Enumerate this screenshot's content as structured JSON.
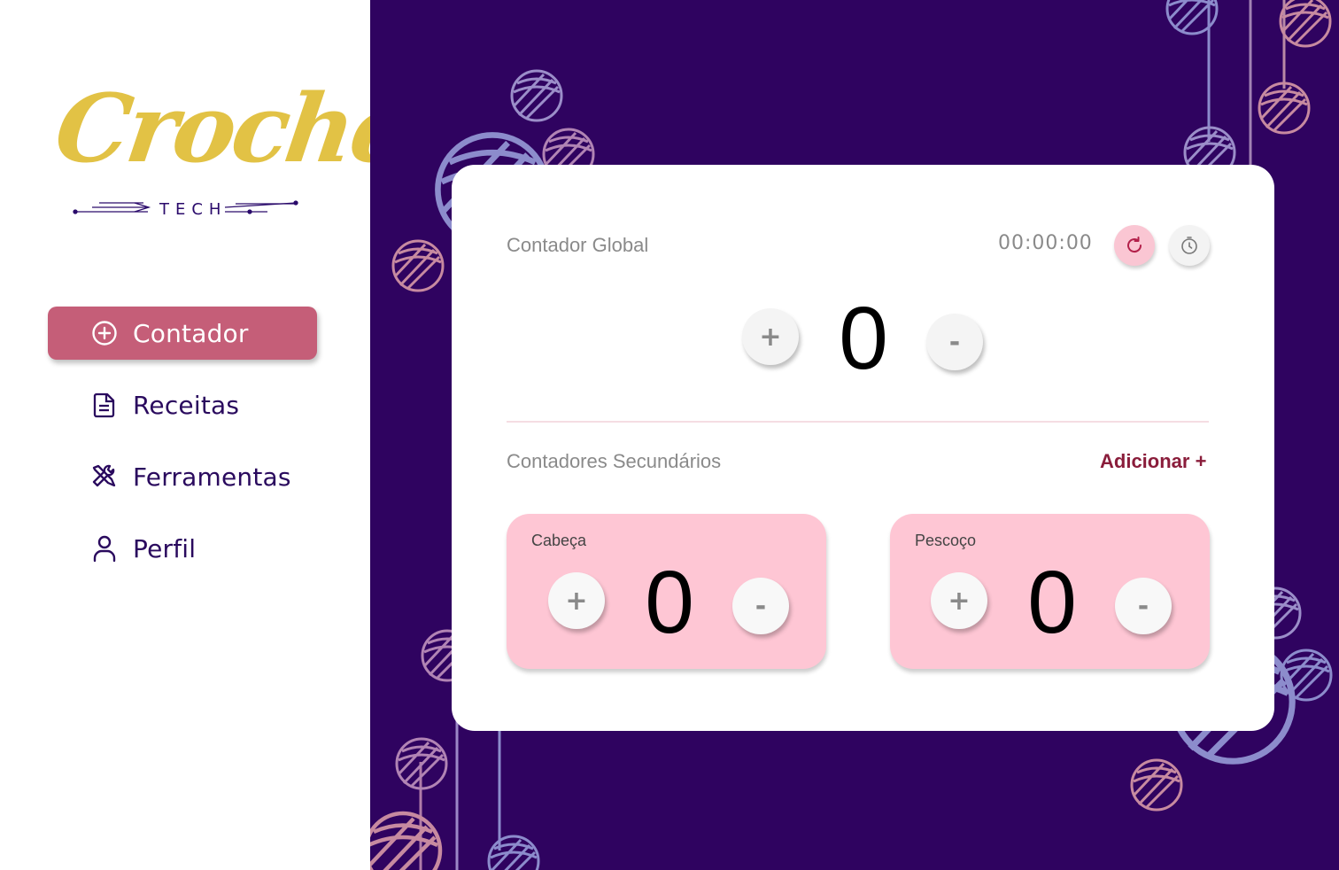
{
  "brand": {
    "script": "Crochê",
    "tag": "TECH",
    "color": "#e2c245"
  },
  "sidebar": {
    "items": [
      {
        "label": "Contador",
        "icon": "plus-circle-icon",
        "active": true
      },
      {
        "label": "Receitas",
        "icon": "document-icon",
        "active": false
      },
      {
        "label": "Ferramentas",
        "icon": "tools-icon",
        "active": false
      },
      {
        "label": "Perfil",
        "icon": "user-icon",
        "active": false
      }
    ]
  },
  "global_counter": {
    "title": "Contador Global",
    "timer": "00:00:00",
    "value": "0",
    "plus_label": "+",
    "minus_label": "-",
    "reset_icon": "reset-icon",
    "stopwatch_icon": "stopwatch-icon"
  },
  "secondary": {
    "title": "Contadores Secundários",
    "add_label": "Adicionar +",
    "counters": [
      {
        "label": "Cabeça",
        "value": "0",
        "plus_label": "+",
        "minus_label": "-"
      },
      {
        "label": "Pescoço",
        "value": "0",
        "plus_label": "+",
        "minus_label": "-"
      }
    ]
  },
  "colors": {
    "background": "#2f0360",
    "active_nav": "#c55e78",
    "accent_link": "#8a1d3b",
    "sub_card": "#fec6d4",
    "reset_button": "#fac6d3"
  }
}
